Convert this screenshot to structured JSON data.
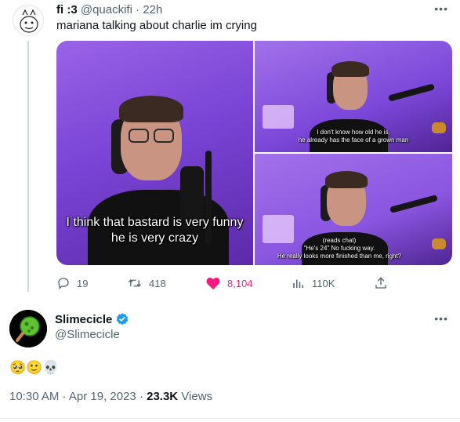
{
  "quoted_tweet": {
    "display_name": "fi :3",
    "handle": "@quackifi",
    "separator": " · ",
    "time": "22h",
    "text": "mariana talking about charlie im crying",
    "media": {
      "main_caption_line1": "I think that bastard is very funny",
      "main_caption_line2": "he is very crazy",
      "top_right_caption_line1": "I don't know how old he is,",
      "top_right_caption_line2": "he already has the face of a grown man",
      "bottom_right_caption_line1": "(reads chat)",
      "bottom_right_caption_line2": "\"He's 24\" No fucking way.",
      "bottom_right_caption_line3": "He really looks more finished than me, right?"
    },
    "actions": {
      "replies": "19",
      "retweets": "418",
      "likes": "8,104",
      "views": "110K"
    }
  },
  "main_tweet": {
    "display_name": "Slimecicle",
    "handle": "@Slimecicle",
    "emoji_text": "🥺🙂💀",
    "time": "10:30 AM · Apr 19, 2023 · ",
    "views_count": "23.3K",
    "views_label": " Views"
  },
  "colors": {
    "text": "#0f1419",
    "muted": "#536471",
    "like_pink": "#f91880",
    "verified_blue": "#1d9bf0"
  },
  "icons": [
    "reply-icon",
    "retweet-icon",
    "heart-icon",
    "views-icon",
    "share-icon",
    "verified-icon",
    "more-icon"
  ]
}
